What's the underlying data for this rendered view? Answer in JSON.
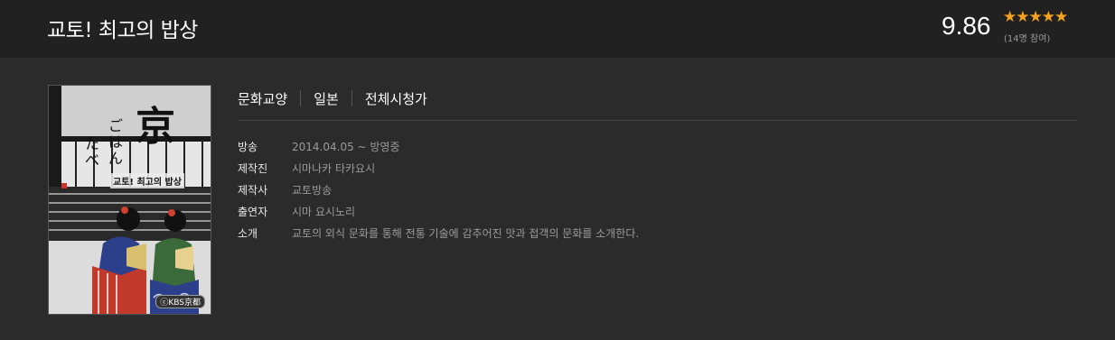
{
  "header": {
    "title": "교토! 최고의 밥상",
    "rating": "9.86",
    "stars": "★★★★★",
    "participants": "(14명 참여)"
  },
  "poster": {
    "caption": "교토! 최고의 밥상",
    "kbs_mark": "ⓒKBS京都"
  },
  "tags": [
    "문화교양",
    "일본",
    "전체시청가"
  ],
  "info": [
    {
      "label": "방송",
      "value": "2014.04.05 ~ 방영중"
    },
    {
      "label": "제작진",
      "value": "시마나카 타카요시"
    },
    {
      "label": "제작사",
      "value": "교토방송"
    },
    {
      "label": "출연자",
      "value": "시마 요시노리"
    },
    {
      "label": "소개",
      "value": "교토의 외식 문화를 통해 전통 기술에 감추어진 맛과 접객의 문화를 소개한다."
    }
  ],
  "colors": {
    "header_bg": "#212121",
    "page_bg": "#2b2b2b",
    "star": "#f2a31b",
    "muted_text": "#9a9a9a"
  }
}
